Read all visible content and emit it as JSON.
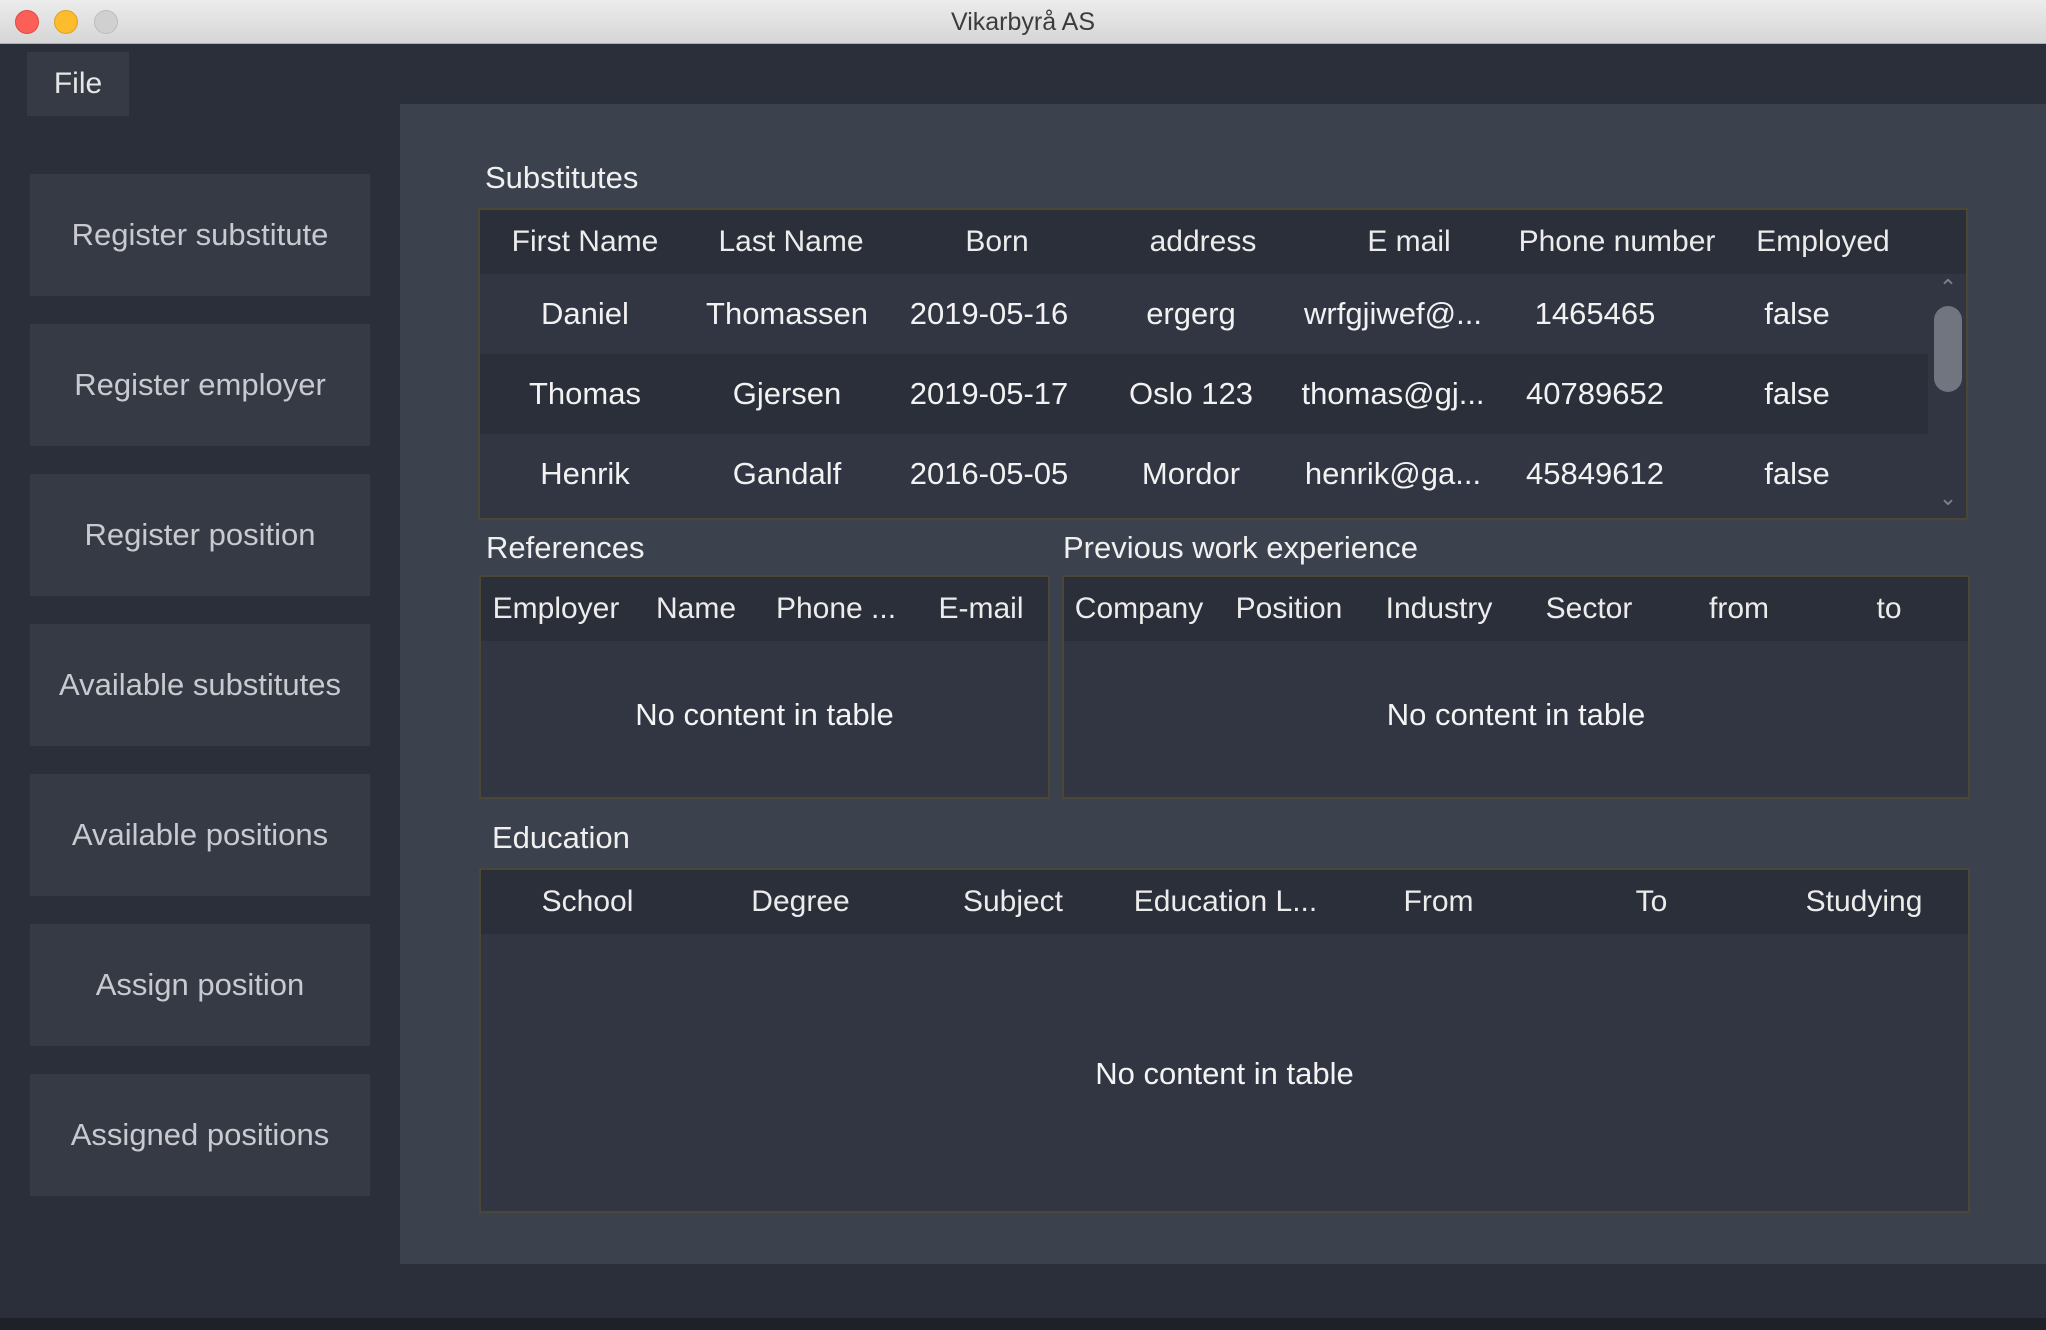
{
  "window": {
    "title": "Vikarbyrå AS"
  },
  "menu": {
    "file_label": "File"
  },
  "sidebar": {
    "items": [
      {
        "label": "Register substitute"
      },
      {
        "label": "Register employer"
      },
      {
        "label": "Register position"
      },
      {
        "label": "Available substitutes"
      },
      {
        "label": "Available positions"
      },
      {
        "label": "Assign position"
      },
      {
        "label": "Assigned positions"
      }
    ]
  },
  "substitutes": {
    "title": "Substitutes",
    "columns": [
      "First Name",
      "Last Name",
      "Born",
      "address",
      "E mail",
      "Phone number",
      "Employed"
    ],
    "rows": [
      [
        "Daniel",
        "Thomassen",
        "2019-05-16",
        "ergerg",
        "wrfgjiwef@...",
        "1465465",
        "false"
      ],
      [
        "Thomas",
        "Gjersen",
        "2019-05-17",
        "Oslo 123",
        "thomas@gj...",
        "40789652",
        "false"
      ],
      [
        "Henrik",
        "Gandalf",
        "2016-05-05",
        "Mordor",
        "henrik@ga...",
        "45849612",
        "false"
      ]
    ]
  },
  "references": {
    "title": "References",
    "columns": [
      "Employer",
      "Name",
      "Phone ...",
      "E-mail"
    ],
    "empty_text": "No content in table"
  },
  "work_experience": {
    "title": "Previous work experience",
    "columns": [
      "Company",
      "Position",
      "Industry",
      "Sector",
      "from",
      "to"
    ],
    "empty_text": "No content in table"
  },
  "education": {
    "title": "Education",
    "columns": [
      "School",
      "Degree",
      "Subject",
      "Education L...",
      "From",
      "To",
      "Studying"
    ],
    "empty_text": "No content in table"
  },
  "icons": {
    "scroll_up": "chevron-up-icon",
    "scroll_down": "chevron-down-icon"
  },
  "colors": {
    "background": "#2b2f39",
    "panel": "#3c414e",
    "button": "#353a45",
    "table_border": "#4a4737",
    "close": "#fc5f57",
    "minimize": "#fdbc2e",
    "maximize": "#d0d0d0"
  }
}
